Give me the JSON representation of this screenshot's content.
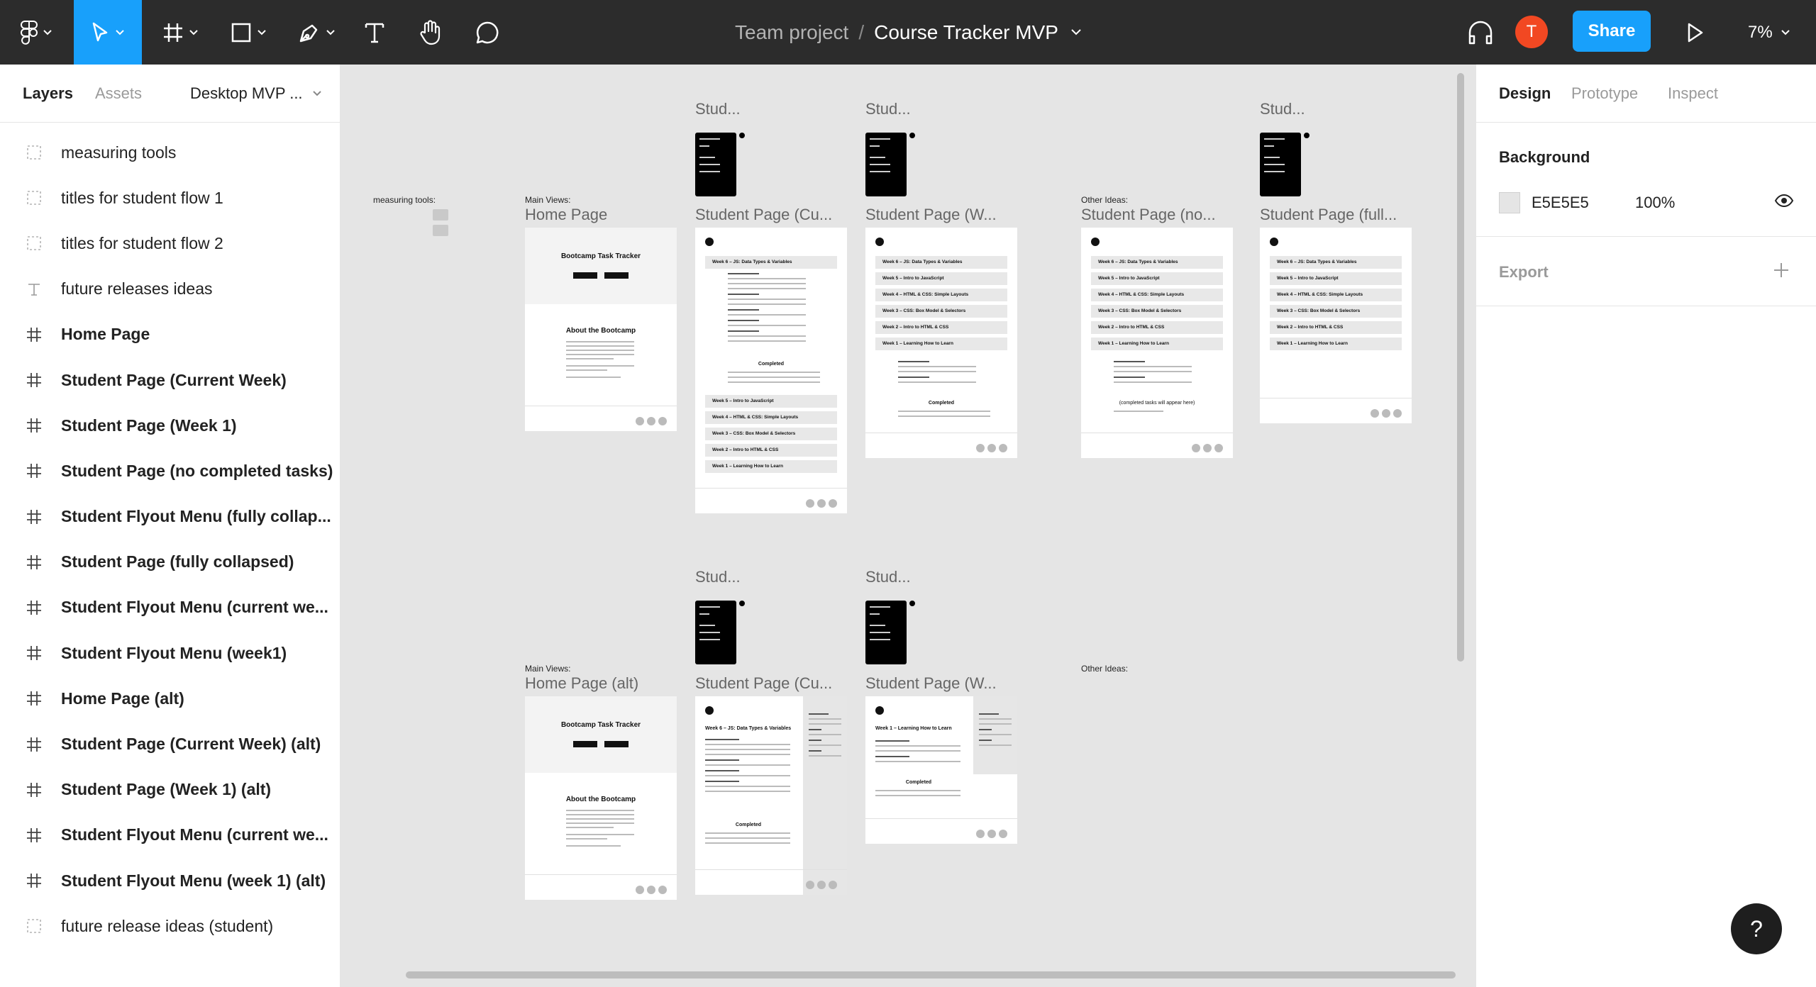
{
  "toolbar": {
    "breadcrumb_team": "Team project",
    "breadcrumb_sep": "/",
    "file_name": "Course Tracker MVP",
    "avatar_initial": "T",
    "share_label": "Share",
    "zoom": "7%",
    "tools": [
      "figma-menu-icon",
      "move-tool-icon",
      "frame-tool-icon",
      "shape-tool-icon",
      "pen-tool-icon",
      "text-tool-icon",
      "hand-tool-icon",
      "comment-tool-icon"
    ],
    "accent": "#18a0fb",
    "avatar_color": "#f24822"
  },
  "left_panel": {
    "tabs": {
      "layers": "Layers",
      "assets": "Assets"
    },
    "page": "Desktop MVP ...",
    "layers": [
      {
        "type": "group",
        "label": "measuring tools"
      },
      {
        "type": "group",
        "label": "titles for student flow 1"
      },
      {
        "type": "group",
        "label": "titles for student flow 2"
      },
      {
        "type": "text",
        "label": "future releases ideas"
      },
      {
        "type": "frame",
        "label": "Home Page"
      },
      {
        "type": "frame",
        "label": "Student Page (Current Week)"
      },
      {
        "type": "frame",
        "label": "Student Page (Week 1)"
      },
      {
        "type": "frame",
        "label": "Student Page (no completed tasks)"
      },
      {
        "type": "frame",
        "label": "Student Flyout Menu (fully collap..."
      },
      {
        "type": "frame",
        "label": "Student Page (fully collapsed)"
      },
      {
        "type": "frame",
        "label": "Student Flyout Menu (current we..."
      },
      {
        "type": "frame",
        "label": "Student Flyout Menu (week1)"
      },
      {
        "type": "frame",
        "label": "Home Page (alt)"
      },
      {
        "type": "frame",
        "label": "Student Page (Current Week) (alt)"
      },
      {
        "type": "frame",
        "label": "Student Page (Week 1) (alt)"
      },
      {
        "type": "frame",
        "label": "Student Flyout Menu (current we..."
      },
      {
        "type": "frame",
        "label": "Student Flyout Menu (week 1) (alt)"
      },
      {
        "type": "group",
        "label": "future release ideas (student)"
      }
    ]
  },
  "canvas": {
    "background": "#e5e5e5",
    "measuring_tools_label": "measuring tools:",
    "main_views_label": "Main Views:",
    "other_ideas_label": "Other Ideas:",
    "stud_label": "Stud...",
    "frame_names": {
      "home": "Home Page",
      "current": "Student Page (Cu...",
      "week1": "Student Page (W...",
      "no_completed": "Student Page (no...",
      "full": "Student Page (full...",
      "home_alt": "Home Page (alt)",
      "current_alt": "Student Page (Cu...",
      "week1_alt": "Student Page (W..."
    },
    "home_title": "Bootcamp Task Tracker",
    "home_about": "About the Bootcamp",
    "completed": "Completed",
    "completed_placeholder": "(completed tasks will appear here)",
    "weeks_full": [
      "Week 6 – JS: Data Types & Variables",
      "Week 5 – Intro to JavaScript",
      "Week 4 – HTML & CSS: Simple Layouts",
      "Week 3 – CSS: Box Model & Selectors",
      "Week 2 – Intro to HTML & CSS",
      "Week 1 – Learning How to Learn"
    ],
    "week1_alt_head": "Week 1 – Learning How to Learn",
    "week6_alt_head": "Week 6 – JS: Data Types & Variables"
  },
  "right_panel": {
    "tabs": {
      "design": "Design",
      "prototype": "Prototype",
      "inspect": "Inspect"
    },
    "background_label": "Background",
    "background_hex": "E5E5E5",
    "background_opacity": "100%",
    "export_label": "Export"
  },
  "help": "?"
}
